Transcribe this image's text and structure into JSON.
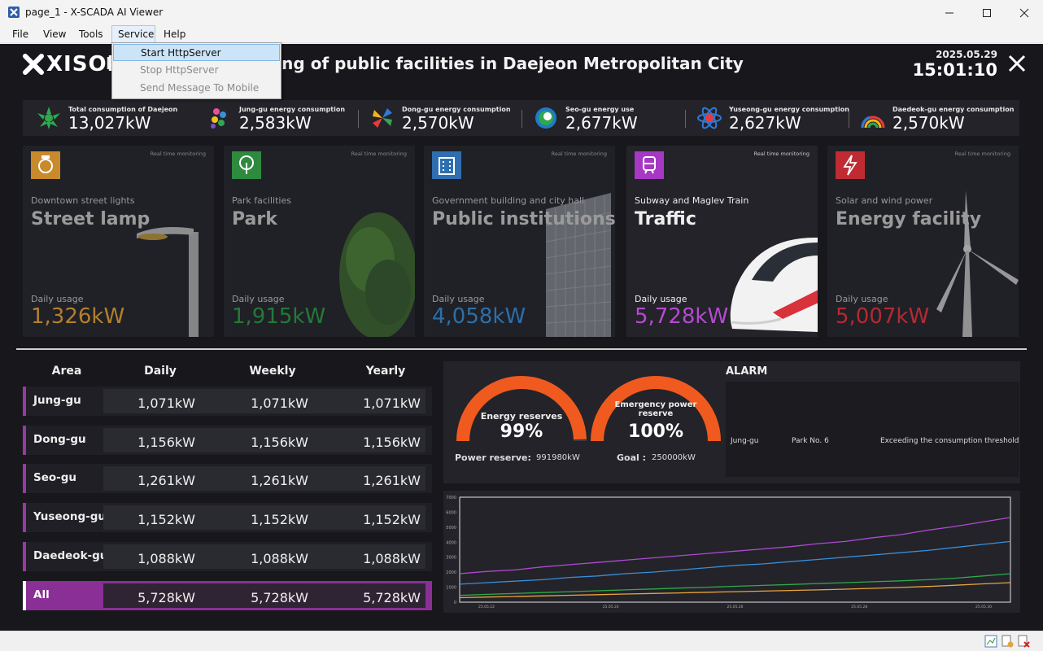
{
  "window": {
    "title": "page_1 - X-SCADA AI Viewer"
  },
  "menu": {
    "items": [
      "File",
      "View",
      "Tools",
      "Service",
      "Help"
    ],
    "service_dropdown": [
      "Start HttpServer",
      "Stop HttpServer",
      "Send Message To Mobile"
    ]
  },
  "header": {
    "logo": "XISOM",
    "title": "Electricity monitoring of public facilities in Daejeon Metropolitan City",
    "date": "2025.05.29",
    "time": "15:01:10"
  },
  "kpis": [
    {
      "label": "Total consumption of Daejeon",
      "value": "13,027kW"
    },
    {
      "label": "Jung-gu energy consumption",
      "value": "2,583kW"
    },
    {
      "label": "Dong-gu energy consumption",
      "value": "2,570kW"
    },
    {
      "label": "Seo-gu energy use",
      "value": "2,677kW"
    },
    {
      "label": "Yuseong-gu energy consumption",
      "value": "2,627kW"
    },
    {
      "label": "Daedeok-gu energy consumption",
      "value": "2,570kW"
    }
  ],
  "cards": [
    {
      "rt": "Real time monitoring",
      "sub": "Downtown street lights",
      "big": "Street lamp",
      "du": "Daily usage",
      "value": "1,326kW",
      "color": "#d6932c",
      "icon_color": "#c98a2b",
      "icon": "lamp-icon"
    },
    {
      "rt": "Real time monitoring",
      "sub": "Park facilities",
      "big": "Park",
      "du": "Daily usage",
      "value": "1,915kW",
      "color": "#2faa4a",
      "icon_color": "#2d8a3e",
      "icon": "tree-icon"
    },
    {
      "rt": "Real time monitoring",
      "sub": "Government building and city hall",
      "big": "Public institutions",
      "du": "Daily usage",
      "value": "4,058kW",
      "color": "#3a8fd8",
      "icon_color": "#2f6fb0",
      "icon": "building-icon"
    },
    {
      "rt": "Real time monitoring",
      "sub": "Subway and Maglev Train",
      "big": "Traffic",
      "du": "Daily usage",
      "value": "5,728kW",
      "color": "#b54ad0",
      "icon_color": "#a638c4",
      "icon": "train-icon"
    },
    {
      "rt": "Real time monitoring",
      "sub": "Solar and wind power",
      "big": "Energy facility",
      "du": "Daily usage",
      "value": "5,007kW",
      "color": "#d8323a",
      "icon_color": "#c02b33",
      "icon": "bolt-icon"
    }
  ],
  "table": {
    "headers": [
      "Area",
      "Daily",
      "Weekly",
      "Yearly"
    ],
    "rows": [
      {
        "area": "Jung-gu",
        "daily": "1,071kW",
        "weekly": "1,071kW",
        "yearly": "1,071kW"
      },
      {
        "area": "Dong-gu",
        "daily": "1,156kW",
        "weekly": "1,156kW",
        "yearly": "1,156kW"
      },
      {
        "area": "Seo-gu",
        "daily": "1,261kW",
        "weekly": "1,261kW",
        "yearly": "1,261kW"
      },
      {
        "area": "Yuseong-gu",
        "daily": "1,152kW",
        "weekly": "1,152kW",
        "yearly": "1,152kW"
      },
      {
        "area": "Daedeok-gu",
        "daily": "1,088kW",
        "weekly": "1,088kW",
        "yearly": "1,088kW"
      },
      {
        "area": "All",
        "daily": "5,728kW",
        "weekly": "5,728kW",
        "yearly": "5,728kW"
      }
    ]
  },
  "gauges": {
    "energy": {
      "label": "Energy reserves",
      "percent": "99%",
      "fraction": 0.99,
      "foot_label": "Power reserve:",
      "foot_value": "991980kW"
    },
    "emergency": {
      "label": "Emergency power reserve",
      "percent": "100%",
      "fraction": 1.0,
      "foot_label": "Goal :",
      "foot_value": "250000kW"
    },
    "color": "#f05a1e"
  },
  "alarm": {
    "title": "ALARM",
    "entries": [
      {
        "area": "Jung-gu",
        "facility": "Park No. 6",
        "message": "Exceeding the consumption threshold"
      }
    ]
  },
  "chart_data": {
    "type": "line",
    "ylim": [
      0,
      7000
    ],
    "yticks": [
      "0",
      "1000",
      "2000",
      "3000",
      "4000",
      "5000",
      "6000",
      "7000"
    ],
    "x": [
      0,
      1,
      2,
      3,
      4,
      5,
      6,
      7,
      8,
      9,
      10,
      11,
      12,
      13,
      14,
      15,
      16,
      17,
      18,
      19,
      20
    ],
    "xtick_labels": [
      "25.05.22",
      "25.05.24",
      "25.05.26",
      "25.05.28",
      "25.05.30"
    ],
    "series": [
      {
        "color": "#b04ad2",
        "values": [
          1900,
          2050,
          2150,
          2350,
          2500,
          2650,
          2800,
          2950,
          3100,
          3250,
          3400,
          3550,
          3700,
          3900,
          4050,
          4300,
          4500,
          4800,
          5050,
          5350,
          5650
        ]
      },
      {
        "color": "#3a8fd8",
        "values": [
          1200,
          1300,
          1400,
          1500,
          1650,
          1750,
          1900,
          2000,
          2150,
          2300,
          2450,
          2550,
          2700,
          2850,
          3000,
          3150,
          3300,
          3450,
          3650,
          3850,
          4050
        ]
      },
      {
        "color": "#2faa4a",
        "values": [
          450,
          520,
          580,
          640,
          700,
          760,
          820,
          880,
          940,
          1000,
          1060,
          1120,
          1180,
          1240,
          1300,
          1360,
          1420,
          1500,
          1600,
          1750,
          1900
        ]
      },
      {
        "color": "#e8a53c",
        "values": [
          300,
          340,
          380,
          420,
          460,
          500,
          540,
          580,
          620,
          660,
          700,
          740,
          780,
          820,
          870,
          920,
          980,
          1050,
          1130,
          1220,
          1300
        ]
      }
    ]
  }
}
